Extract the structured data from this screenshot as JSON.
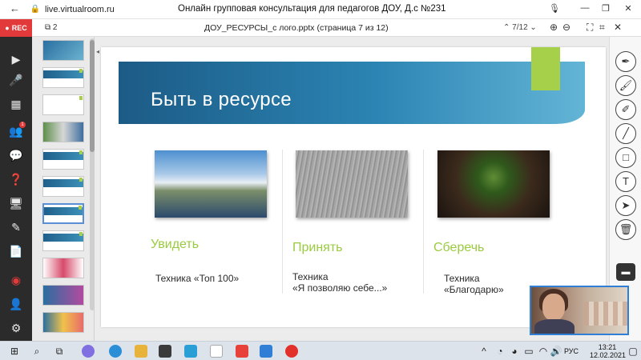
{
  "browser": {
    "url": "live.virtualroom.ru",
    "title": "Онлайн групповая консультация для педагогов ДОУ, Д.с №231"
  },
  "sidebar_left": {
    "rec_label": "REC",
    "participants_badge": "1"
  },
  "document": {
    "page_count_icon_label": "2",
    "filename": "ДОУ_РЕСУРСЫ_с лого.pptx (страница 7 из 12)",
    "page_indicator": "7/12"
  },
  "slide": {
    "title": "Быть в ресурсе",
    "columns": [
      {
        "heading": "Увидеть",
        "caption_lines": [
          "Техника «Топ 100»"
        ]
      },
      {
        "heading": "Принять",
        "caption_lines": [
          "Техника",
          "«Я позволяю себе...»"
        ]
      },
      {
        "heading": "Сберечь",
        "caption_lines": [
          "Техника",
          "«Благодарю»"
        ]
      }
    ]
  },
  "taskbar": {
    "language": "РУС",
    "time": "13:21",
    "date": "12.02.2021"
  },
  "colors": {
    "accent_green": "#a6d04a",
    "banner_blue": "#1c5b86",
    "rec_red": "#e23a3a"
  }
}
